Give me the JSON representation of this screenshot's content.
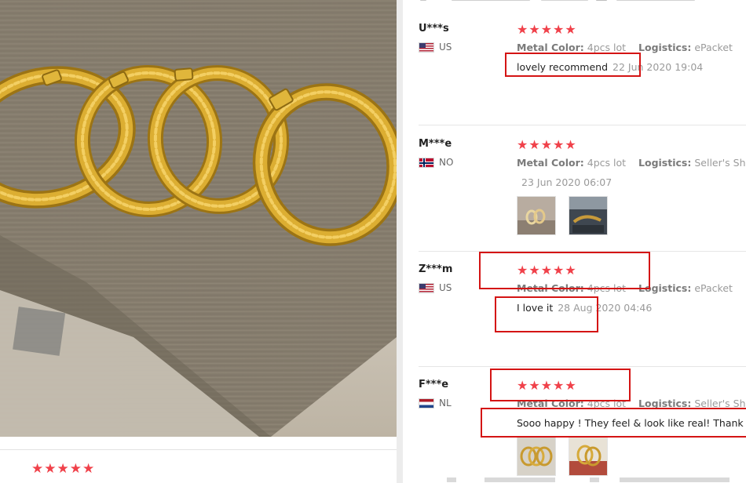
{
  "left": {
    "photo_subject": "four gold bangles",
    "rating_stars": "★★★★★"
  },
  "reviews": [
    {
      "user": "U***s",
      "flag": "us-flag-icon",
      "country": "US",
      "stars": "★★★★★",
      "metal_color_label": "Metal Color:",
      "metal_color_value": "4pcs lot",
      "logistics_label": "Logistics:",
      "logistics_value": "ePacket",
      "comment": "lovely recommend",
      "date": "22 Jun 2020 19:04"
    },
    {
      "user": "M***e",
      "flag": "no-flag-icon",
      "country": "NO",
      "stars": "★★★★★",
      "metal_color_label": "Metal Color:",
      "metal_color_value": "4pcs lot",
      "logistics_label": "Logistics:",
      "logistics_value": "Seller's Shipping",
      "comment": "",
      "date": "23 Jun 2020 06:07"
    },
    {
      "user": "Z***m",
      "flag": "us-flag-icon",
      "country": "US",
      "stars": "★★★★★",
      "metal_color_label": "Metal Color:",
      "metal_color_value": "4pcs lot",
      "logistics_label": "Logistics:",
      "logistics_value": "ePacket",
      "comment": "I love it",
      "date": "28 Aug 2020 04:46"
    },
    {
      "user": "F***e",
      "flag": "nl-flag-icon",
      "country": "NL",
      "stars": "★★★★★",
      "metal_color_label": "Metal Color:",
      "metal_color_value": "4pcs lot",
      "logistics_label": "Logistics:",
      "logistics_value": "Seller's Shipping",
      "comment": "Sooo happy ! They feel & look like real! Thank u s",
      "date": ""
    }
  ],
  "colors": {
    "star": "#f0414a",
    "highlight": "#d41414",
    "gold": "#d1a12a"
  }
}
